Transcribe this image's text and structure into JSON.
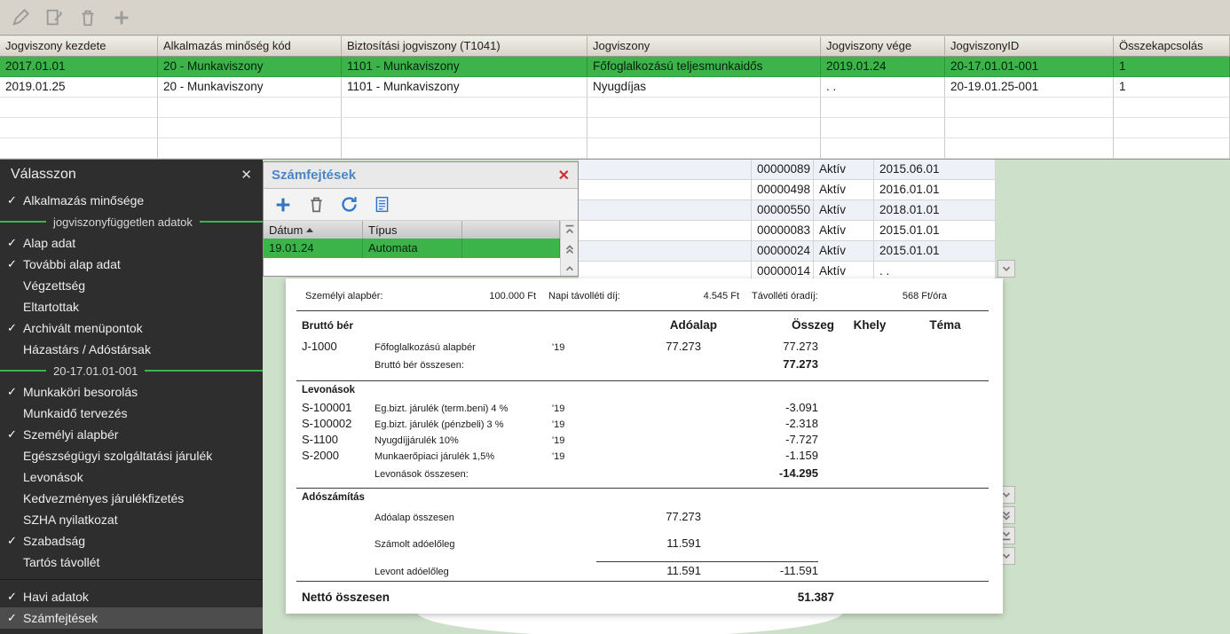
{
  "colors": {
    "accent_green": "#3cb44a",
    "panel_title_blue": "#4a86c4",
    "close_red": "#cc3030",
    "sidebar_bg": "#2e2e2e",
    "background_green": "#cde0c9"
  },
  "main_toolbar": {
    "icons": [
      "edit",
      "copy-document",
      "delete",
      "add"
    ]
  },
  "top_table": {
    "columns": [
      "Jogviszony kezdete",
      "Alkalmazás minőség kód",
      "Biztosítási jogviszony (T1041)",
      "Jogviszony",
      "Jogviszony vége",
      "JogviszonyID",
      "Összekapcsolás"
    ],
    "rows": [
      [
        "2017.01.01",
        "20 - Munkaviszony",
        "1101 - Munkaviszony",
        "Főfoglalkozású teljesmunkaidős",
        "2019.01.24",
        "20-17.01.01-001",
        "1"
      ],
      [
        "2019.01.25",
        "20 - Munkaviszony",
        "1101 - Munkaviszony",
        "Nyugdíjas",
        ". .",
        "20-19.01.25-001",
        "1"
      ]
    ]
  },
  "sidebar": {
    "title": "Válasszon",
    "close": "✕",
    "items": [
      {
        "label": "Alkalmazás minősége",
        "check": "✓"
      },
      {
        "label": "jogviszonyfüggetlen adatok",
        "type": "section"
      },
      {
        "label": "Alap adat",
        "check": "✓"
      },
      {
        "label": "További alap adat",
        "check": "✓"
      },
      {
        "label": "Végzettség",
        "check": ""
      },
      {
        "label": "Eltartottak",
        "check": ""
      },
      {
        "label": "Archivált menüpontok",
        "check": "✓"
      },
      {
        "label": "Házastárs / Adóstársak",
        "check": ""
      },
      {
        "label": "20-17.01.01-001",
        "type": "section"
      },
      {
        "label": "Munkaköri besorolás",
        "check": "✓"
      },
      {
        "label": "Munkaidő tervezés",
        "check": ""
      },
      {
        "label": "Személyi alapbér",
        "check": "✓"
      },
      {
        "label": "Egészségügyi szolgáltatási járulék",
        "check": ""
      },
      {
        "label": "Levonások",
        "check": ""
      },
      {
        "label": "Kedvezményes járulékfizetés",
        "check": ""
      },
      {
        "label": "SZHA nyilatkozat",
        "check": ""
      },
      {
        "label": "Szabadság",
        "check": "✓"
      },
      {
        "label": "Tartós távollét",
        "check": ""
      },
      {
        "label": "Havi adatok",
        "check": "✓"
      },
      {
        "label": "Számfejtések",
        "check": "✓",
        "selected": true
      }
    ]
  },
  "payroll_panel": {
    "title": "Számfejtések",
    "close": "✕",
    "columns": [
      "Dátum",
      "Típus"
    ],
    "rows": [
      [
        "19.01.24",
        "Automata"
      ]
    ]
  },
  "records_table": {
    "rows": [
      [
        "00000089",
        "Aktív",
        "2015.06.01"
      ],
      [
        "00000498",
        "Aktív",
        "2016.01.01"
      ],
      [
        "00000550",
        "Aktív",
        "2018.01.01"
      ],
      [
        "00000083",
        "Aktív",
        "2015.01.01"
      ],
      [
        "00000024",
        "Aktív",
        "2015.01.01"
      ],
      [
        "00000014",
        "Aktív",
        ". ."
      ]
    ]
  },
  "payroll_doc": {
    "summary": {
      "label1": "Személyi alapbér:",
      "value1": "100.000 Ft",
      "label2": "Napi távolléti díj:",
      "value2": "4.545 Ft",
      "label3": "Távolléti óradíj:",
      "value3": "568 Ft/óra"
    },
    "headers": {
      "adoalap": "Adóalap",
      "osszeg": "Összeg",
      "khely": "Khely",
      "tema": "Téma"
    },
    "brutto": {
      "title": "Bruttó bér",
      "rows": [
        {
          "code": "J-1000",
          "desc": "Főfoglalkozású alapbér",
          "year": "'19",
          "adoalap": "77.273",
          "osszeg": "77.273"
        }
      ],
      "total_label": "Bruttó bér összesen:",
      "total": "77.273"
    },
    "levonasok": {
      "title": "Levonások",
      "rows": [
        {
          "code": "S-100001",
          "desc": "Eg.bizt. járulék (term.beni) 4 %",
          "year": "'19",
          "osszeg": "-3.091"
        },
        {
          "code": "S-100002",
          "desc": "Eg.bizt. járulék (pénzbeli) 3 %",
          "year": "'19",
          "osszeg": "-2.318"
        },
        {
          "code": "S-1100",
          "desc": "Nyugdíjjárulék 10%",
          "year": "'19",
          "osszeg": "-7.727"
        },
        {
          "code": "S-2000",
          "desc": "Munkaerőpiaci járulék 1,5%",
          "year": "'19",
          "osszeg": "-1.159"
        }
      ],
      "total_label": "Levonások összesen:",
      "total": "-14.295"
    },
    "adoszamitas": {
      "title": "Adószámítás",
      "rows": [
        {
          "desc": "Adóalap összesen",
          "adoalap": "77.273"
        },
        {
          "desc": "Számolt adóelőleg",
          "adoalap": "11.591"
        },
        {
          "desc": "Levont adóelőleg",
          "adoalap": "11.591",
          "osszeg": "-11.591"
        }
      ]
    },
    "netto_label": "Nettó összesen",
    "netto_value": "51.387"
  }
}
